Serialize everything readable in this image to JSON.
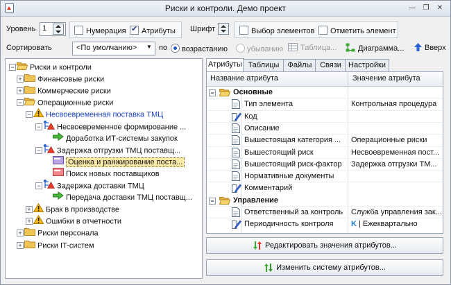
{
  "window": {
    "title": "Риски и контроли. Демо проект"
  },
  "toolbar": {
    "level_label": "Уровень",
    "level_value": "1",
    "numbering_label": "Нумерация",
    "numbering_checked": false,
    "attributes_label": "Атрибуты",
    "attributes_checked": true,
    "font_label": "Шрифт",
    "select_elements_label": "Выбор элементов",
    "select_elements_checked": false,
    "mark_element_label": "Отметить элемент",
    "mark_element_checked": false
  },
  "sortbar": {
    "sort_label": "Сортировать",
    "sort_value": "<По умолчанию>",
    "by_label": "по",
    "asc_label": "возрастанию",
    "desc_label": "убыванию",
    "table_label": "Таблица...",
    "diagram_label": "Диаграмма...",
    "up_label": "Вверх"
  },
  "tree": {
    "nodes": [
      {
        "label": "Риски и контроли",
        "icon": "folder-open-icon",
        "name": "tree-root"
      },
      {
        "label": "Финансовые риски",
        "icon": "folder-icon",
        "name": "tree-financial"
      },
      {
        "label": "Коммерческие риски",
        "icon": "folder-icon",
        "name": "tree-commercial"
      },
      {
        "label": "Операционные риски",
        "icon": "folder-open-icon",
        "name": "tree-operational"
      },
      {
        "label": "Несвоевременная поставка ТМЦ",
        "icon": "warning-icon",
        "name": "tree-late-delivery"
      },
      {
        "label": "Несвоевременное формирование ...",
        "icon": "risk-factor-icon",
        "name": "tree-late-forming"
      },
      {
        "label": "Доработка ИТ-системы закупок",
        "icon": "arrow-right-icon",
        "name": "tree-it-upgrade"
      },
      {
        "label": "Задержка отгрузки ТМЦ поставщ...",
        "icon": "risk-factor-icon",
        "name": "tree-shipment-delay"
      },
      {
        "label": "Оценка и ранжирование поста...",
        "icon": "procedure-icon",
        "name": "tree-evaluation"
      },
      {
        "label": "Поиск новых поставщиков",
        "icon": "procedure-red-icon",
        "name": "tree-new-suppliers"
      },
      {
        "label": "Задержка доставки ТМЦ",
        "icon": "risk-factor-icon",
        "name": "tree-delivery-delay"
      },
      {
        "label": "Передача доставки ТМЦ поставщ...",
        "icon": "arrow-right-icon",
        "name": "tree-delivery-transfer"
      },
      {
        "label": "Брак в производстве",
        "icon": "warning-icon",
        "name": "tree-defects"
      },
      {
        "label": "Ошибки в отчетности",
        "icon": "warning-icon",
        "name": "tree-reporting-errors"
      },
      {
        "label": "Риски персонала",
        "icon": "folder-icon",
        "name": "tree-personnel"
      },
      {
        "label": "Риски IT-систем",
        "icon": "folder-icon",
        "name": "tree-it"
      }
    ]
  },
  "tabs": [
    "Атрибуты",
    "Таблицы",
    "Файлы",
    "Связи",
    "Настройки"
  ],
  "grid": {
    "col_name": "Название атрибута",
    "col_value": "Значение атрибута",
    "groups": [
      {
        "title": "Основные",
        "rows": [
          {
            "name": "Тип элемента",
            "value": "Контрольная процедура",
            "icon": "doc-icon"
          },
          {
            "name": "Код",
            "value": "",
            "icon": "edit-icon"
          },
          {
            "name": "Описание",
            "value": "",
            "icon": "doc-icon"
          },
          {
            "name": "Вышестоящая категория ...",
            "value": "Операционные риски",
            "icon": "doc-icon"
          },
          {
            "name": "Вышестоящий риск",
            "value": "Несвоевременная пост...",
            "icon": "doc-icon"
          },
          {
            "name": "Вышестоящий риск-фактор",
            "value": "Задержка отгрузки ТМ...",
            "icon": "doc-icon"
          },
          {
            "name": "Нормативные документы",
            "value": "",
            "icon": "doc-icon"
          },
          {
            "name": "Комментарий",
            "value": "",
            "icon": "edit-icon"
          }
        ]
      },
      {
        "title": "Управление",
        "rows": [
          {
            "name": "Ответственный за контроль",
            "value": "Служба управления зак...",
            "icon": "doc-icon"
          },
          {
            "name": "Периодичность контроля",
            "value": "| Ежеквартально",
            "value_prefix": "K",
            "icon": "edit-icon"
          }
        ]
      }
    ]
  },
  "buttons": {
    "edit_values": "Редактировать значения атрибутов...",
    "change_system": "Изменить систему атрибутов..."
  },
  "colors": {
    "accent": "#1f44c8",
    "selection": "#fbe9a7",
    "folder": "#e8b84a",
    "warning": "#f2b21d",
    "arrow": "#3aa832"
  }
}
